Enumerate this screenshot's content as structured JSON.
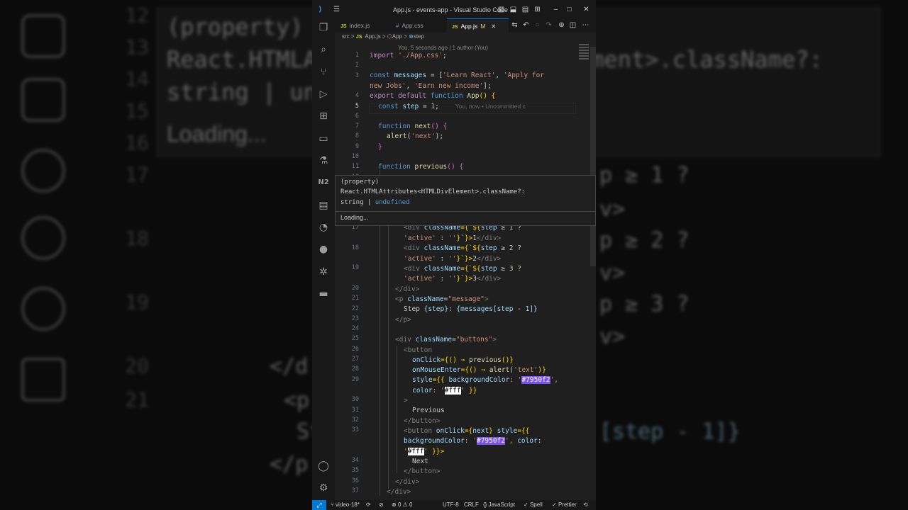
{
  "background": {
    "line_numbers": [
      "12",
      "13",
      "14",
      "15",
      "16",
      "17",
      "18",
      "19",
      "20",
      "21"
    ],
    "hover_lines": [
      "(property)",
      "React.HTMLAttributes<HTMLDivElement>.className?:",
      "string | undefined",
      "Loading..."
    ],
    "code_fragments": [
      "p ≥ 1 ?",
      "v>",
      "p ≥ 2 ?",
      "v>",
      "p ≥ 3 ?",
      "v>",
      "</d",
      "<p",
      "St",
      "</p",
      "[step - 1]}"
    ]
  },
  "window": {
    "title": "App.js - events-app - Visual Studio Code",
    "titlebar_icons": [
      "menu-icon",
      "layout-sidebar-icon",
      "layout-panel-icon",
      "layout-secondary-icon",
      "layout-custom-icon",
      "minimize-icon",
      "maximize-icon",
      "close-icon"
    ]
  },
  "activity_bar": {
    "top": [
      "explorer-icon",
      "search-icon",
      "source-control-icon",
      "run-debug-icon",
      "extensions-icon",
      "remote-explorer-icon",
      "testing-icon",
      "nx-icon",
      "clipboard-icon",
      "gitlens-icon",
      "github-icon",
      "kubernetes-icon",
      "docker-icon"
    ],
    "bottom": [
      "account-icon",
      "settings-gear-icon"
    ]
  },
  "tabs": [
    {
      "icon": "JS",
      "label": "index.js",
      "active": false
    },
    {
      "icon": "#",
      "label": "App.css",
      "active": false
    },
    {
      "icon": "JS",
      "label": "App.js",
      "badge": "M",
      "active": true
    }
  ],
  "tab_actions": [
    "compare-icon",
    "go-back-icon",
    "circle-icon",
    "go-forward-icon",
    "open-changes-icon",
    "split-editor-icon",
    "more-actions-icon"
  ],
  "breadcrumb": {
    "folder": "src",
    "sep1": ">",
    "file": "App.js",
    "sep2": ">",
    "component": "App",
    "sep3": ">",
    "symbol": "step"
  },
  "blame_header": "You, 5 seconds ago | 1 author (You)",
  "editor_lines": [
    {
      "n": "1"
    },
    {
      "n": "2"
    },
    {
      "n": "3"
    },
    {
      "n": ""
    },
    {
      "n": "4"
    },
    {
      "n": "5"
    },
    {
      "n": "6"
    },
    {
      "n": "7"
    },
    {
      "n": "8"
    },
    {
      "n": "9"
    },
    {
      "n": "10"
    },
    {
      "n": "11"
    },
    {
      "n": "12"
    },
    {
      "n": "13"
    },
    {
      "n": "14"
    },
    {
      "n": "15"
    },
    {
      "n": "16"
    },
    {
      "n": "17"
    },
    {
      "n": ""
    },
    {
      "n": "18"
    },
    {
      "n": ""
    },
    {
      "n": "19"
    },
    {
      "n": ""
    },
    {
      "n": "20"
    },
    {
      "n": "21"
    },
    {
      "n": "22"
    },
    {
      "n": "23"
    },
    {
      "n": "24"
    },
    {
      "n": "25"
    },
    {
      "n": "26"
    },
    {
      "n": "27"
    },
    {
      "n": "28"
    },
    {
      "n": "29"
    },
    {
      "n": ""
    },
    {
      "n": "30"
    },
    {
      "n": "31"
    },
    {
      "n": "32"
    },
    {
      "n": "33"
    },
    {
      "n": ""
    },
    {
      "n": ""
    },
    {
      "n": "34"
    },
    {
      "n": "35"
    },
    {
      "n": "36"
    },
    {
      "n": "37"
    }
  ],
  "code": {
    "l1_kw": "import",
    "l1_str": "'./App.css'",
    "l1_end": ";",
    "l3_kw": "const",
    "l3_var": "messages",
    "l3_eq": " = [",
    "l3_s1": "'Learn React'",
    "l3_c1": ", ",
    "l3_s2": "'Apply for",
    "l3b_s2": "new Jobs'",
    "l3b_c": ", ",
    "l3b_s3": "'Earn new income'",
    "l3b_end": "];",
    "l4_kw1": "export",
    "l4_kw2": "default",
    "l4_kw3": "function",
    "l4_fn": "App",
    "l4_end": "() {",
    "l5_kw": "const",
    "l5_var": "step",
    "l5_eq": " = ",
    "l5_num": "1",
    "l5_end": ";",
    "l5_ghost": "You, now • Uncommitted c",
    "l7_kw": "function",
    "l7_fn": "next",
    "l7_end": "() {",
    "l8_fn": "alert",
    "l8_p1": "(",
    "l8_str": "'next'",
    "l8_p2": ");",
    "l9": "}",
    "l11_kw": "function",
    "l11_fn": "previous",
    "l11_end": "() {",
    "l17a": "<div",
    "l17b": "className",
    "l17c": "={`${",
    "l17d": "step",
    "l17e": " ≥ ",
    "l17f": "1",
    "l17g": " ?",
    "l17h": "'active'",
    "l17i": " : ",
    "l17j": "''",
    "l17k": "}`}>",
    "l17l": "1",
    "l17m": "</div>",
    "l18f": "2",
    "l18l": "2",
    "l19f": "3",
    "l19l": "3",
    "l20": "</div>",
    "l21a": "<p",
    "l21b": "className",
    "l21c": "=",
    "l21d": "\"message\"",
    "l21e": ">",
    "l22a": "Step ",
    "l22b": "{step}",
    "l22c": ": ",
    "l22d": "{messages[step - 1]}",
    "l23": "</p>",
    "l25a": "<div",
    "l25b": "className",
    "l25c": "=",
    "l25d": "\"buttons\"",
    "l25e": ">",
    "l26": "<button",
    "l27a": "onClick",
    "l27b": "={() ⇒ ",
    "l27c": "previous",
    "l27d": "()}",
    "l28a": "onMouseEnter",
    "l28b": "={() ⇒ ",
    "l28c": "alert",
    "l28d": "(",
    "l28e": "'text'",
    "l28f": ")}",
    "l29a": "style",
    "l29b": "={{ ",
    "l29c": "backgroundColor",
    "l29d": ": '",
    "l29e": "#7950f2",
    "l29f": "',",
    "l29g": "color",
    "l29h": ": '",
    "l29i": "#fff",
    "l29j": "' }}",
    "l30": ">",
    "l31": "Previous",
    "l32": "</button>",
    "l33a": "<button",
    "l33b": "onClick",
    "l33c": "={",
    "l33d": "next",
    "l33e": "} ",
    "l33f": "style",
    "l33g": "={{",
    "l33h": "backgroundColor",
    "l33i": ": '",
    "l33j": "#7950f2",
    "l33k": "', ",
    "l33l": "color",
    "l33m": ":",
    "l33n": "'",
    "l33o": "#fff",
    "l33p": "' }}>",
    "l34": "Next",
    "l35": "</button>",
    "l36": "</div>",
    "l37": "</div>"
  },
  "hover": {
    "line1": "(property)",
    "line2": "React.HTMLAttributes<HTMLDivElement>.className?:",
    "line3a": "string",
    "line3b": " | ",
    "line3c": "undefined",
    "loading": "Loading..."
  },
  "statusbar": {
    "branch": "video-18*",
    "errors": "0",
    "warnings": "0",
    "encoding": "UTF-8",
    "eol": "CRLF",
    "language": "JavaScript",
    "spell": "Spell",
    "prettier": "Prettier"
  },
  "colors": {
    "accent": "#0078d4",
    "swatch_purple": "#7950f2",
    "swatch_white": "#ffffff",
    "editor_bg": "#1f1f1f",
    "chrome_bg": "#181818"
  }
}
